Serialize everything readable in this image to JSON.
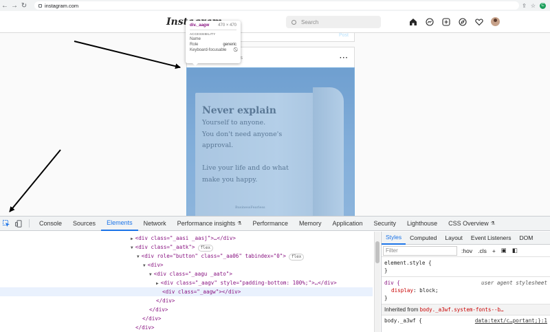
{
  "browser": {
    "url": "instagram.com",
    "profile_initial": "C"
  },
  "instagram": {
    "logo": "Instagram",
    "search_placeholder": "Search",
    "top_card_action": "Post",
    "post_username": "ss",
    "post_more": "···",
    "post_image_text": {
      "headline": "Never explain",
      "lines": [
        "Yourself to anyone.",
        "You don't need anyone's",
        "approval.",
        "",
        "Live your life and do what",
        "make you happy."
      ],
      "credit": "BusinessFearless"
    }
  },
  "tooltip": {
    "element": "div._aagw",
    "size": "470 × 470",
    "section": "ACCESSIBILITY",
    "rows": [
      {
        "key": "Name",
        "value": ""
      },
      {
        "key": "Role",
        "value": "generic"
      },
      {
        "key": "Keyboard-focusable",
        "value": "⃠"
      }
    ]
  },
  "devtools": {
    "tabs": [
      "Console",
      "Sources",
      "Elements",
      "Network",
      "Performance insights",
      "Performance",
      "Memory",
      "Application",
      "Security",
      "Lighthouse",
      "CSS Overview"
    ],
    "active_tab": "Elements",
    "dom_lines": [
      {
        "text": "<div class=\"_aasi _aasj\">…</div>",
        "indent": 0
      },
      {
        "text": "<div class=\"_aatk\">",
        "badge": "flex",
        "indent": 0
      },
      {
        "text": "<div role=\"button\" class=\"_aa06\" tabindex=\"0\">",
        "badge": "flex",
        "indent": 1
      },
      {
        "text": "<div>",
        "indent": 2
      },
      {
        "text": "<div class=\"_aagu _aato\">",
        "indent": 3
      },
      {
        "text": "<div class=\"_aagv\" style=\"padding-bottom: 100%;\">…</div>",
        "indent": 4
      },
      {
        "text": "<div class=\"_aagw\"></div>",
        "indent": 4,
        "selected": true
      },
      {
        "text": "</div>",
        "indent": 3
      },
      {
        "text": "</div>",
        "indent": 2
      },
      {
        "text": "</div>",
        "indent": 1
      },
      {
        "text": "</div>",
        "indent": 0
      }
    ],
    "styles": {
      "tabs": [
        "Styles",
        "Computed",
        "Layout",
        "Event Listeners",
        "DOM"
      ],
      "active_tab": "Styles",
      "filter_placeholder": "Filter",
      "hov": ":hov",
      "cls": ".cls",
      "add": "+",
      "element_style": "element.style {",
      "close_brace": "}",
      "ua_selector": "div {",
      "ua_label": "user agent stylesheet",
      "ua_prop": "display",
      "ua_value": "block",
      "inherited_label": "Inherited from",
      "inherited_link": "body._a3wf.system-fonts--b…",
      "last_selector": "body._a3wf {",
      "last_source": "data:text/c…portant;}:1"
    }
  },
  "colors": {
    "accent": "#1a73e8",
    "tag": "#881280",
    "attr": "#994500",
    "attr_value": "#1a1aa6",
    "highlight": "#6fa8dc"
  }
}
